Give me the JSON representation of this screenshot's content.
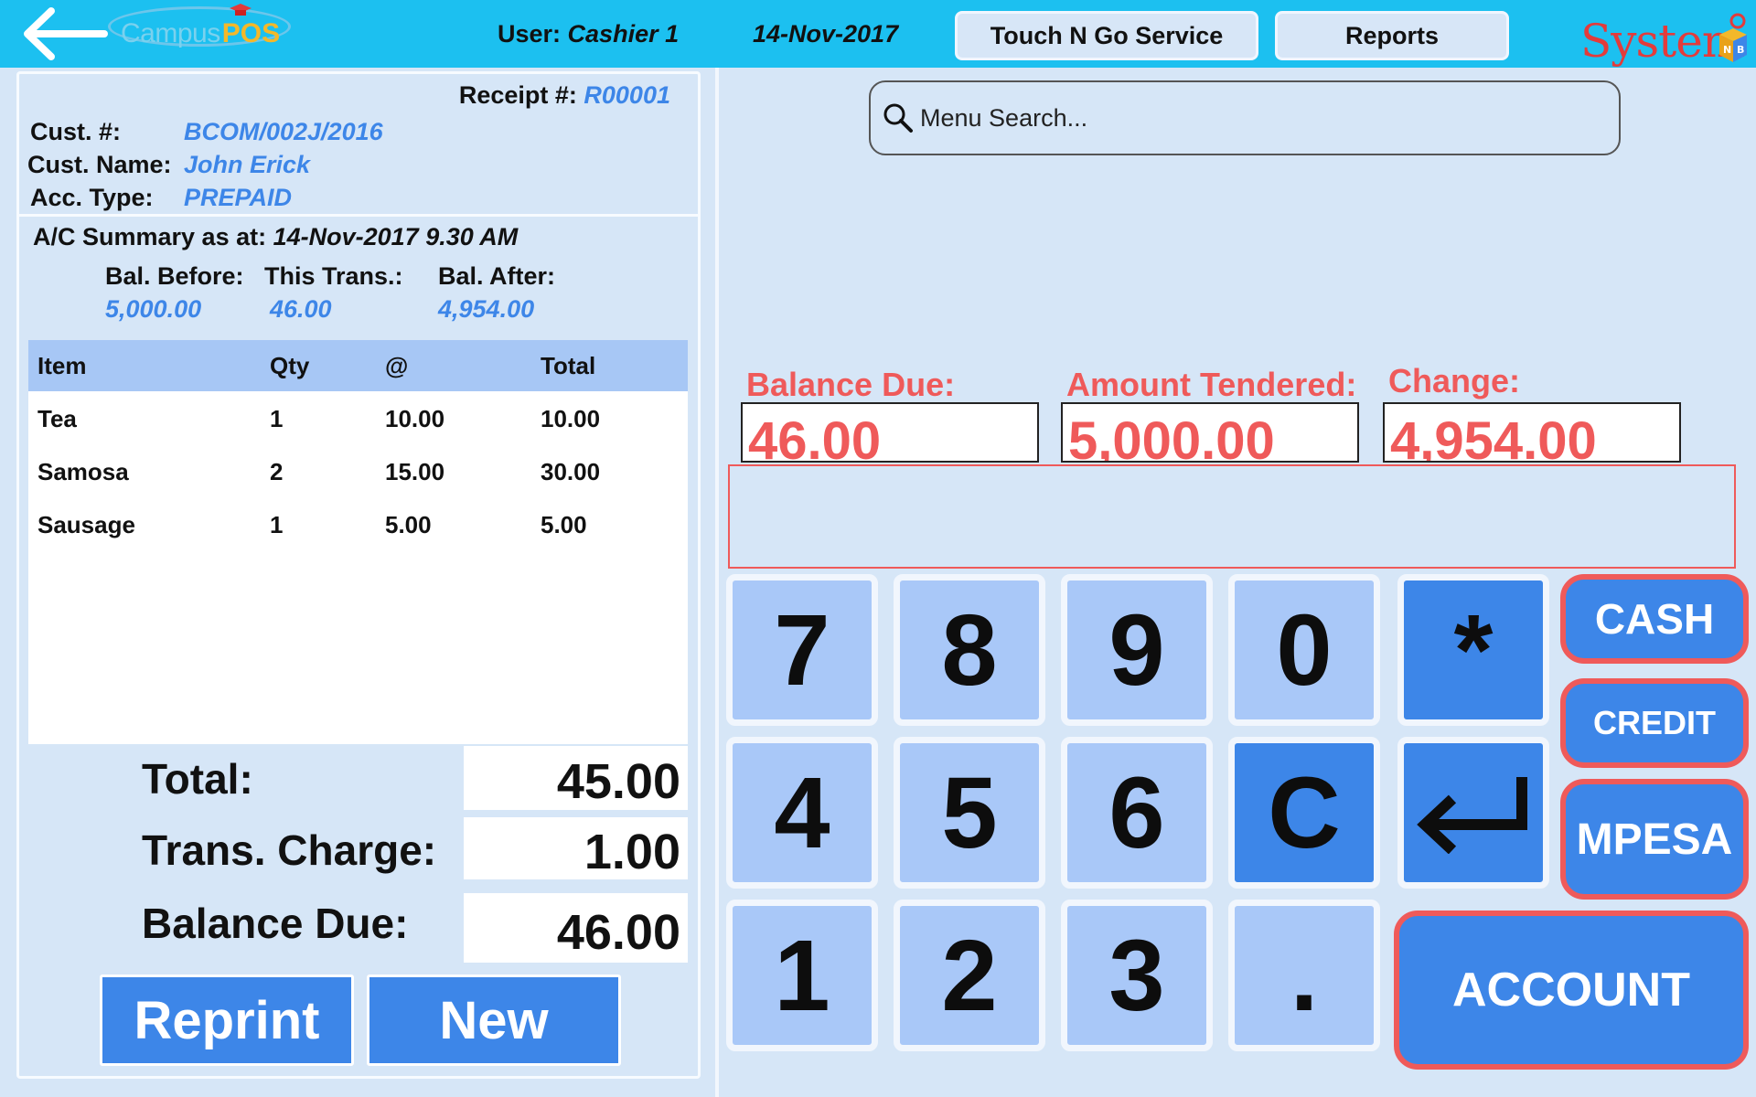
{
  "header": {
    "logo": {
      "campus": "Campus",
      "pos": "POS"
    },
    "user_label": "User:",
    "user_name": "Cashier 1",
    "date": "14-Nov-2017",
    "touch_n_go_label": "Touch N Go Service",
    "reports_label": "Reports",
    "brand": "System",
    "brand_badge": "NB",
    "colors": {
      "bar": "#1cc0f0",
      "brand": "#e33b3b"
    }
  },
  "receipt": {
    "label": "Receipt #:",
    "number": "R00001",
    "cust_no_label": "Cust. #:",
    "cust_no": "BCOM/002J/2016",
    "cust_name_label": "Cust. Name:",
    "cust_name": "John Erick",
    "acc_type_label": "Acc. Type:",
    "acc_type": "PREPAID"
  },
  "summary": {
    "title": "A/C Summary as at:",
    "as_at": "14-Nov-2017 9.30 AM",
    "bal_before_label": "Bal. Before:",
    "this_trans_label": "This Trans.:",
    "bal_after_label": "Bal. After:",
    "bal_before": "5,000.00",
    "this_trans": "46.00",
    "bal_after": "4,954.00"
  },
  "items": {
    "columns": [
      "Item",
      "Qty",
      "@",
      "Total"
    ],
    "rows": [
      [
        "Tea",
        "1",
        "10.00",
        "10.00"
      ],
      [
        "Samosa",
        "2",
        "15.00",
        "30.00"
      ],
      [
        "Sausage",
        "1",
        "5.00",
        "5.00"
      ]
    ]
  },
  "totals": {
    "total_label": "Total:",
    "total": "45.00",
    "charge_label": "Trans. Charge:",
    "charge": "1.00",
    "due_label": "Balance Due:",
    "due": "46.00"
  },
  "actions": {
    "reprint": "Reprint",
    "new": "New"
  },
  "search": {
    "placeholder": "Menu Search..."
  },
  "payment": {
    "balance_due_label": "Balance Due:",
    "balance_due": "46.00",
    "tendered_label": "Amount Tendered:",
    "tendered": "5,000.00",
    "change_label": "Change:",
    "change": "4,954.00",
    "accent": "#ef5a5a"
  },
  "keypad": {
    "keys": [
      "7",
      "8",
      "9",
      "0",
      "*",
      "4",
      "5",
      "6",
      "C",
      "1",
      "2",
      "3",
      "."
    ],
    "enter_icon": "enter-arrow-icon"
  },
  "pay_methods": {
    "cash": "CASH",
    "credit": "CREDIT",
    "mpesa": "MPESA",
    "account": "ACCOUNT",
    "color": "#3d86e8"
  }
}
